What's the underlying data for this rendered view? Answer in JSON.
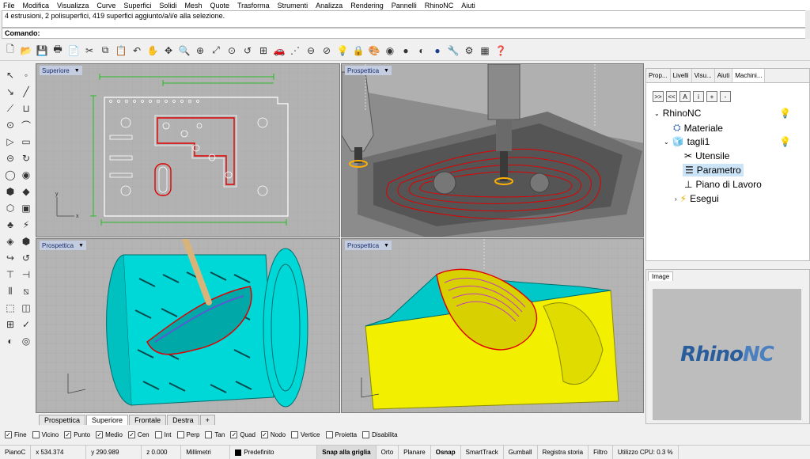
{
  "menu": [
    "File",
    "Modifica",
    "Visualizza",
    "Curve",
    "Superfici",
    "Solidi",
    "Mesh",
    "Quote",
    "Trasforma",
    "Strumenti",
    "Analizza",
    "Rendering",
    "Pannelli",
    "RhinoNC",
    "Aiuti"
  ],
  "history_text": "4 estrusioni, 2 polisuperfici, 419 superfici aggiunto/a/i/e alla selezione.",
  "command_label": "Comando:",
  "viewports": {
    "top_left": "Superiore",
    "top_right": "Prospettica",
    "bottom_left": "Prospettica",
    "bottom_right": "Prospettica"
  },
  "viewport_tabs": [
    "Prospettica",
    "Superiore",
    "Frontale",
    "Destra",
    "+"
  ],
  "active_tab": "Superiore",
  "osnap": [
    {
      "label": "Fine",
      "checked": true
    },
    {
      "label": "Vicino",
      "checked": false
    },
    {
      "label": "Punto",
      "checked": true
    },
    {
      "label": "Medio",
      "checked": true
    },
    {
      "label": "Cen",
      "checked": true
    },
    {
      "label": "Int",
      "checked": false
    },
    {
      "label": "Perp",
      "checked": false
    },
    {
      "label": "Tan",
      "checked": false
    },
    {
      "label": "Quad",
      "checked": true
    },
    {
      "label": "Nodo",
      "checked": true
    },
    {
      "label": "Vertice",
      "checked": false
    },
    {
      "label": "Proietta",
      "checked": false
    },
    {
      "label": "Disabilita",
      "checked": false
    }
  ],
  "status": {
    "plane": "PianoC",
    "x": "x 534.374",
    "y": "y 290.989",
    "z": "z 0.000",
    "units": "Millimetri",
    "layer": "Predefinito",
    "toggles": [
      "Snap alla griglia",
      "Orto",
      "Planare",
      "Osnap",
      "SmartTrack",
      "Gumball",
      "Registra storia",
      "Filtro"
    ],
    "cpu": "Utilizzo CPU: 0.3 %"
  },
  "right_panel": {
    "tabs": [
      "Prop...",
      "Livelli",
      "Visu...",
      "Aiuti",
      "Machini..."
    ],
    "tree": {
      "root": "RhinoNC",
      "material": "Materiale",
      "cut": "tagli1",
      "tool": "Utensile",
      "param": "Parametro",
      "plane": "Piano di Lavoro",
      "run": "Esegui"
    },
    "tree_buttons": [
      ">>",
      "<<",
      "A",
      "i",
      "+",
      "-"
    ]
  },
  "image_panel": {
    "tab": "Image",
    "logo_a": "Rhino",
    "logo_b": "NC"
  },
  "colors": {
    "cyan_part": "#00d8d8",
    "yellow_part": "#f2f000",
    "toolpath": "#e00000",
    "viewport_bg": "#b4b4b4",
    "part_grey": "#9a9a9a"
  }
}
